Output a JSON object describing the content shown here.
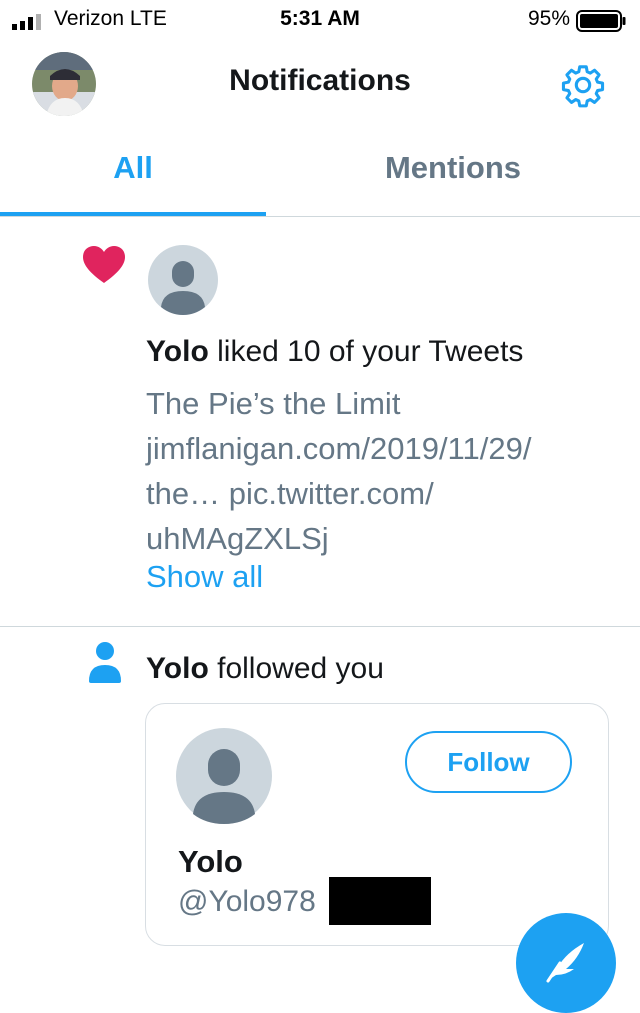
{
  "status_bar": {
    "carrier": "Verizon  LTE",
    "time": "5:31 AM",
    "battery": "95%"
  },
  "header": {
    "title": "Notifications"
  },
  "tabs": [
    {
      "label": "All",
      "active": true
    },
    {
      "label": "Mentions",
      "active": false
    }
  ],
  "like_notification": {
    "user": "Yolo",
    "action": " liked 10 of your Tweets",
    "tweet_lines": [
      "The Pie’s the Limit",
      "jimflanigan.com/2019/11/29/",
      "the… pic.twitter.com/",
      "uhMAgZXLSj"
    ],
    "show_all": "Show all"
  },
  "follow_notification": {
    "user": "Yolo",
    "action": " followed you",
    "card": {
      "name": "Yolo",
      "handle": "@Yolo978",
      "follow_label": "Follow"
    }
  },
  "colors": {
    "accent": "#1da1f2",
    "like": "#e0245e",
    "secondary_text": "#657786"
  }
}
